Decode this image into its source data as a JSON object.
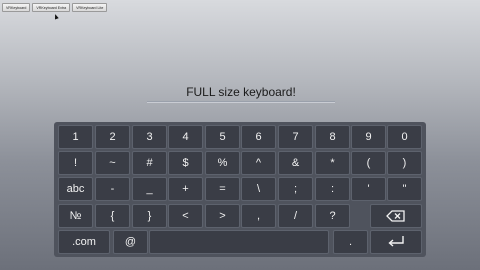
{
  "toolbar": {
    "buttons": [
      "VRKeyboard",
      "VRKeyboard Extra",
      "VRKeyboard Lite"
    ]
  },
  "input": {
    "text": "FULL size keyboard!"
  },
  "keyboard": {
    "rows": [
      [
        "1",
        "2",
        "3",
        "4",
        "5",
        "6",
        "7",
        "8",
        "9",
        "0"
      ],
      [
        "!",
        "~",
        "#",
        "$",
        "%",
        "^",
        "&",
        "*",
        "(",
        ")"
      ],
      [
        "abc",
        "-",
        "_",
        "+",
        "=",
        "\\",
        ";",
        ":",
        "'",
        "\""
      ],
      [
        "№",
        "{",
        "}",
        "<",
        ">",
        ",",
        "/",
        "?"
      ],
      [
        ".com",
        "@",
        "",
        "."
      ]
    ],
    "backspace_icon": "backspace-icon",
    "enter_icon": "enter-icon"
  },
  "colors": {
    "key_bg": "#3a3d46",
    "keyboard_bg": "#4f535d",
    "key_text": "#f2f2f2"
  }
}
